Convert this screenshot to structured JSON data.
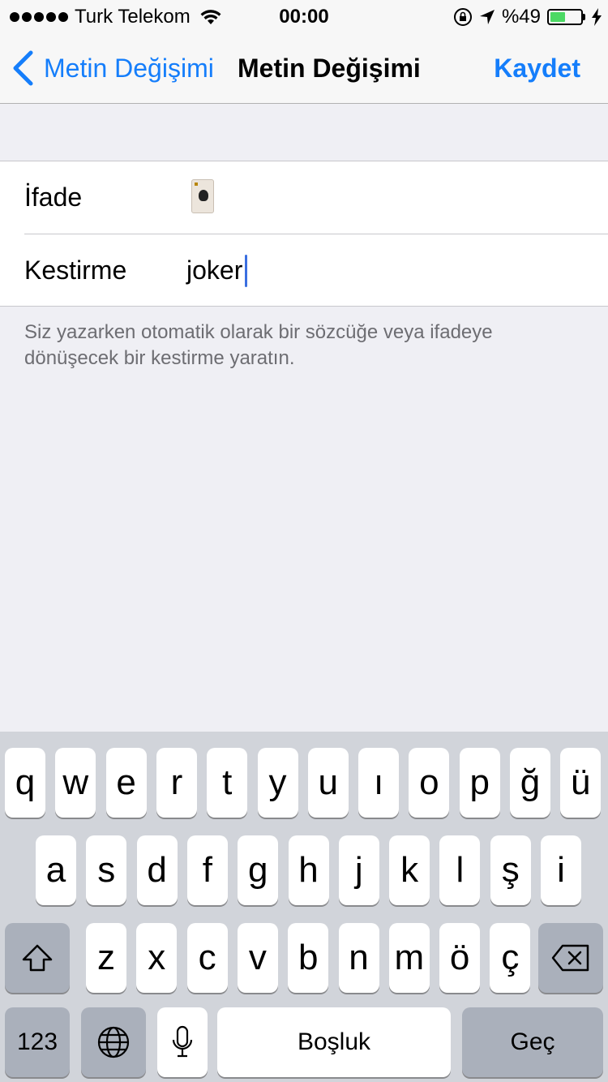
{
  "status_bar": {
    "carrier": "Turk Telekom",
    "time": "00:00",
    "battery_text": "%49",
    "battery_level": 0.49,
    "battery_color": "#4cd964"
  },
  "nav": {
    "back_label": "Metin Değişimi",
    "title": "Metin Değişimi",
    "save_label": "Kaydet",
    "accent_color": "#157efb"
  },
  "form": {
    "phrase_label": "İfade",
    "phrase_value_icon": "joker-card-emoji",
    "shortcut_label": "Kestirme",
    "shortcut_value": "joker"
  },
  "footer_note": "Siz yazarken otomatik olarak bir sözcüğe veya ifadeye dönüşecek bir kestirme yaratın.",
  "keyboard": {
    "row1": [
      "q",
      "w",
      "e",
      "r",
      "t",
      "y",
      "u",
      "ı",
      "o",
      "p",
      "ğ",
      "ü"
    ],
    "row2": [
      "a",
      "s",
      "d",
      "f",
      "g",
      "h",
      "j",
      "k",
      "l",
      "ş",
      "i"
    ],
    "row3": [
      "z",
      "x",
      "c",
      "v",
      "b",
      "n",
      "m",
      "ö",
      "ç"
    ],
    "shift_icon": "shift-icon",
    "delete_icon": "backspace-icon",
    "numbers_label": "123",
    "globe_icon": "globe-icon",
    "mic_icon": "microphone-icon",
    "space_label": "Boşluk",
    "return_label": "Geç"
  }
}
